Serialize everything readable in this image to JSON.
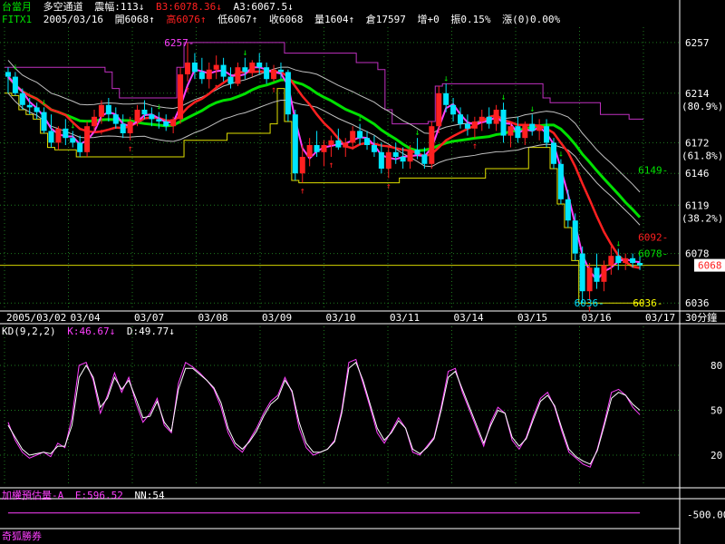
{
  "header1": {
    "symbol": "台當月",
    "strategy": "多空通道",
    "amplitude": "震幅:113↓",
    "b3": "B3:6078.36↓",
    "a3": "A3:6067.5↓"
  },
  "header2": {
    "code": "FITX1",
    "date": "2005/03/16",
    "open": "開6068↑",
    "high": "高6076↑",
    "low": "低6067↑",
    "close": "收6068",
    "volume": "量1604↑",
    "oi": "倉17597",
    "oi_change": "增+0",
    "range": "振0.15%",
    "change": "漲(0)0.00%"
  },
  "kd_header": {
    "name": "KD(9,2,2)",
    "k": "K:46.67↓",
    "d": "D:49.77↓"
  },
  "vol_header": {
    "name": "加權預估量-A",
    "e": "E:596.52",
    "nn": "NN:54"
  },
  "footer_label": "奇狐勝券",
  "colors": {
    "up": "#ff2020",
    "down": "#00e5ff",
    "grid": "#1e7a1e",
    "ma_green": "#00e000",
    "ma_red": "#ff2020",
    "ma_magenta": "#ff40ff",
    "band_upper": "#c030c0",
    "band_lower": "#e0e000",
    "k_line": "#ff40ff",
    "d_line": "#ffffff"
  },
  "chart_data": [
    {
      "type": "candlestick",
      "pane": "price",
      "interval": "30分鐘",
      "ylim": [
        6030,
        6270
      ],
      "y_ticks": [
        {
          "v": 6257,
          "label": "6257"
        },
        {
          "v": 6214,
          "label": "6214",
          "sub": "(80.9%)"
        },
        {
          "v": 6172,
          "label": "6172",
          "sub": "(61.8%)"
        },
        {
          "v": 6146,
          "label": "6146"
        },
        {
          "v": 6119,
          "label": "6119",
          "sub": "(38.2%)"
        },
        {
          "v": 6078,
          "label": "6078"
        },
        {
          "v": 6036,
          "label": "6036"
        }
      ],
      "current_price": "6068",
      "x_labels": [
        "2005/03/02",
        "03/04",
        "03/07",
        "03/08",
        "03/09",
        "03/10",
        "03/11",
        "03/14",
        "03/15",
        "03/16",
        "03/17"
      ],
      "annotations": [
        {
          "text": "6257",
          "x": 30,
          "v": 6257,
          "color": "#ff40ff"
        },
        {
          "text": "6149",
          "x": 119,
          "v": 6149,
          "color": "#00e000"
        },
        {
          "text": "6092",
          "x": 119,
          "v": 6092,
          "color": "#ff2020"
        },
        {
          "text": "6078",
          "x": 119,
          "v": 6078,
          "color": "#00e000"
        },
        {
          "text": "6036",
          "x": 107,
          "v": 6036,
          "color": "#00e5ff"
        },
        {
          "text": "6036",
          "x": 118,
          "v": 6036,
          "color": "#ffff00"
        }
      ],
      "candles": [
        {
          "o": 6232,
          "h": 6236,
          "l": 6214,
          "c": 6228
        },
        {
          "o": 6228,
          "h": 6232,
          "l": 6212,
          "c": 6214
        },
        {
          "o": 6214,
          "h": 6218,
          "l": 6200,
          "c": 6204
        },
        {
          "o": 6204,
          "h": 6210,
          "l": 6196,
          "c": 6202
        },
        {
          "o": 6202,
          "h": 6206,
          "l": 6192,
          "c": 6198
        },
        {
          "o": 6198,
          "h": 6202,
          "l": 6180,
          "c": 6182
        },
        {
          "o": 6182,
          "h": 6196,
          "l": 6168,
          "c": 6172
        },
        {
          "o": 6172,
          "h": 6186,
          "l": 6166,
          "c": 6184
        },
        {
          "o": 6184,
          "h": 6192,
          "l": 6170,
          "c": 6176
        },
        {
          "o": 6176,
          "h": 6182,
          "l": 6168,
          "c": 6172
        },
        {
          "o": 6172,
          "h": 6178,
          "l": 6160,
          "c": 6164
        },
        {
          "o": 6164,
          "h": 6190,
          "l": 6160,
          "c": 6186
        },
        {
          "o": 6186,
          "h": 6200,
          "l": 6180,
          "c": 6194
        },
        {
          "o": 6194,
          "h": 6208,
          "l": 6188,
          "c": 6204
        },
        {
          "o": 6204,
          "h": 6210,
          "l": 6190,
          "c": 6196
        },
        {
          "o": 6196,
          "h": 6202,
          "l": 6184,
          "c": 6188
        },
        {
          "o": 6188,
          "h": 6196,
          "l": 6176,
          "c": 6180
        },
        {
          "o": 6180,
          "h": 6194,
          "l": 6174,
          "c": 6190
        },
        {
          "o": 6190,
          "h": 6204,
          "l": 6186,
          "c": 6200
        },
        {
          "o": 6200,
          "h": 6208,
          "l": 6192,
          "c": 6196
        },
        {
          "o": 6196,
          "h": 6202,
          "l": 6186,
          "c": 6192
        },
        {
          "o": 6192,
          "h": 6198,
          "l": 6184,
          "c": 6190
        },
        {
          "o": 6190,
          "h": 6196,
          "l": 6182,
          "c": 6186
        },
        {
          "o": 6186,
          "h": 6194,
          "l": 6180,
          "c": 6192
        },
        {
          "o": 6192,
          "h": 6236,
          "l": 6188,
          "c": 6230
        },
        {
          "o": 6230,
          "h": 6257,
          "l": 6224,
          "c": 6240
        },
        {
          "o": 6240,
          "h": 6248,
          "l": 6226,
          "c": 6232
        },
        {
          "o": 6232,
          "h": 6244,
          "l": 6222,
          "c": 6226
        },
        {
          "o": 6226,
          "h": 6240,
          "l": 6218,
          "c": 6234
        },
        {
          "o": 6234,
          "h": 6246,
          "l": 6226,
          "c": 6238
        },
        {
          "o": 6238,
          "h": 6244,
          "l": 6224,
          "c": 6228
        },
        {
          "o": 6228,
          "h": 6236,
          "l": 6218,
          "c": 6222
        },
        {
          "o": 6222,
          "h": 6240,
          "l": 6220,
          "c": 6236
        },
        {
          "o": 6236,
          "h": 6244,
          "l": 6226,
          "c": 6232
        },
        {
          "o": 6232,
          "h": 6242,
          "l": 6228,
          "c": 6240
        },
        {
          "o": 6240,
          "h": 6248,
          "l": 6230,
          "c": 6236
        },
        {
          "o": 6236,
          "h": 6240,
          "l": 6222,
          "c": 6226
        },
        {
          "o": 6226,
          "h": 6238,
          "l": 6224,
          "c": 6234
        },
        {
          "o": 6234,
          "h": 6240,
          "l": 6226,
          "c": 6232
        },
        {
          "o": 6232,
          "h": 6234,
          "l": 6190,
          "c": 6196
        },
        {
          "o": 6196,
          "h": 6200,
          "l": 6140,
          "c": 6146
        },
        {
          "o": 6146,
          "h": 6170,
          "l": 6138,
          "c": 6160
        },
        {
          "o": 6160,
          "h": 6176,
          "l": 6152,
          "c": 6170
        },
        {
          "o": 6170,
          "h": 6182,
          "l": 6160,
          "c": 6164
        },
        {
          "o": 6164,
          "h": 6174,
          "l": 6152,
          "c": 6170
        },
        {
          "o": 6170,
          "h": 6178,
          "l": 6160,
          "c": 6174
        },
        {
          "o": 6174,
          "h": 6184,
          "l": 6166,
          "c": 6168
        },
        {
          "o": 6168,
          "h": 6176,
          "l": 6160,
          "c": 6172
        },
        {
          "o": 6172,
          "h": 6186,
          "l": 6166,
          "c": 6182
        },
        {
          "o": 6182,
          "h": 6188,
          "l": 6170,
          "c": 6176
        },
        {
          "o": 6176,
          "h": 6182,
          "l": 6166,
          "c": 6170
        },
        {
          "o": 6170,
          "h": 6178,
          "l": 6160,
          "c": 6164
        },
        {
          "o": 6164,
          "h": 6172,
          "l": 6146,
          "c": 6150
        },
        {
          "o": 6150,
          "h": 6168,
          "l": 6142,
          "c": 6164
        },
        {
          "o": 6164,
          "h": 6172,
          "l": 6154,
          "c": 6160
        },
        {
          "o": 6160,
          "h": 6168,
          "l": 6150,
          "c": 6156
        },
        {
          "o": 6156,
          "h": 6170,
          "l": 6150,
          "c": 6166
        },
        {
          "o": 6166,
          "h": 6176,
          "l": 6158,
          "c": 6162
        },
        {
          "o": 6162,
          "h": 6168,
          "l": 6150,
          "c": 6154
        },
        {
          "o": 6154,
          "h": 6190,
          "l": 6150,
          "c": 6186
        },
        {
          "o": 6186,
          "h": 6220,
          "l": 6180,
          "c": 6214
        },
        {
          "o": 6214,
          "h": 6222,
          "l": 6198,
          "c": 6204
        },
        {
          "o": 6204,
          "h": 6210,
          "l": 6190,
          "c": 6196
        },
        {
          "o": 6196,
          "h": 6202,
          "l": 6184,
          "c": 6188
        },
        {
          "o": 6188,
          "h": 6196,
          "l": 6178,
          "c": 6184
        },
        {
          "o": 6184,
          "h": 6194,
          "l": 6176,
          "c": 6190
        },
        {
          "o": 6190,
          "h": 6200,
          "l": 6182,
          "c": 6194
        },
        {
          "o": 6194,
          "h": 6202,
          "l": 6184,
          "c": 6188
        },
        {
          "o": 6188,
          "h": 6204,
          "l": 6182,
          "c": 6200
        },
        {
          "o": 6200,
          "h": 6206,
          "l": 6172,
          "c": 6178
        },
        {
          "o": 6178,
          "h": 6190,
          "l": 6168,
          "c": 6186
        },
        {
          "o": 6186,
          "h": 6194,
          "l": 6172,
          "c": 6176
        },
        {
          "o": 6176,
          "h": 6190,
          "l": 6170,
          "c": 6188
        },
        {
          "o": 6188,
          "h": 6196,
          "l": 6178,
          "c": 6182
        },
        {
          "o": 6182,
          "h": 6192,
          "l": 6174,
          "c": 6186
        },
        {
          "o": 6186,
          "h": 6192,
          "l": 6168,
          "c": 6172
        },
        {
          "o": 6172,
          "h": 6176,
          "l": 6150,
          "c": 6154
        },
        {
          "o": 6154,
          "h": 6158,
          "l": 6120,
          "c": 6124
        },
        {
          "o": 6124,
          "h": 6132,
          "l": 6100,
          "c": 6106
        },
        {
          "o": 6106,
          "h": 6112,
          "l": 6072,
          "c": 6078
        },
        {
          "o": 6078,
          "h": 6084,
          "l": 6036,
          "c": 6046
        },
        {
          "o": 6046,
          "h": 6070,
          "l": 6038,
          "c": 6066
        },
        {
          "o": 6066,
          "h": 6078,
          "l": 6048,
          "c": 6054
        },
        {
          "o": 6054,
          "h": 6072,
          "l": 6046,
          "c": 6068
        },
        {
          "o": 6068,
          "h": 6084,
          "l": 6060,
          "c": 6076
        },
        {
          "o": 6076,
          "h": 6082,
          "l": 6064,
          "c": 6070
        },
        {
          "o": 6070,
          "h": 6078,
          "l": 6064,
          "c": 6074
        },
        {
          "o": 6074,
          "h": 6078,
          "l": 6066,
          "c": 6070
        },
        {
          "o": 6070,
          "h": 6076,
          "l": 6064,
          "c": 6068
        }
      ]
    },
    {
      "type": "line",
      "pane": "kd",
      "ylim": [
        0,
        100
      ],
      "y_ticks": [
        80,
        50,
        20
      ],
      "series": [
        {
          "name": "K",
          "values": [
            42,
            30,
            22,
            18,
            20,
            22,
            19,
            28,
            25,
            45,
            80,
            82,
            70,
            48,
            60,
            75,
            62,
            72,
            55,
            42,
            48,
            58,
            40,
            35,
            68,
            82,
            79,
            75,
            70,
            64,
            52,
            35,
            26,
            22,
            30,
            38,
            48,
            56,
            60,
            72,
            62,
            38,
            25,
            20,
            22,
            24,
            30,
            50,
            82,
            84,
            68,
            52,
            35,
            28,
            36,
            45,
            38,
            22,
            20,
            26,
            32,
            52,
            76,
            78,
            62,
            50,
            38,
            26,
            42,
            52,
            48,
            30,
            24,
            32,
            46,
            58,
            62,
            52,
            36,
            22,
            18,
            14,
            12,
            24,
            42,
            62,
            64,
            60,
            52,
            47
          ]
        },
        {
          "name": "D",
          "values": [
            40,
            32,
            24,
            20,
            21,
            22,
            21,
            26,
            26,
            40,
            72,
            80,
            72,
            52,
            58,
            72,
            64,
            70,
            58,
            45,
            46,
            56,
            42,
            36,
            64,
            78,
            78,
            74,
            70,
            65,
            55,
            38,
            28,
            24,
            29,
            36,
            46,
            54,
            58,
            70,
            63,
            42,
            28,
            22,
            22,
            24,
            29,
            48,
            78,
            82,
            70,
            54,
            38,
            30,
            35,
            43,
            38,
            24,
            21,
            25,
            31,
            50,
            72,
            76,
            64,
            52,
            40,
            28,
            40,
            50,
            48,
            32,
            26,
            31,
            44,
            56,
            60,
            53,
            38,
            24,
            19,
            16,
            14,
            23,
            40,
            58,
            62,
            60,
            54,
            50
          ]
        }
      ]
    },
    {
      "type": "line",
      "pane": "volume-estimate",
      "ylim": [
        0,
        1000
      ],
      "y_ticks": [
        500
      ],
      "y_tick_labels": [
        "500.00"
      ],
      "series": [
        {
          "values": [
            560,
            560,
            560,
            560,
            560,
            560,
            560,
            560,
            560,
            560,
            560,
            560,
            560,
            560,
            560,
            560,
            560,
            560,
            560,
            560,
            560,
            560,
            560,
            560,
            560,
            560,
            560,
            560,
            560,
            560,
            560,
            560,
            560,
            560,
            560,
            560,
            560,
            560,
            560,
            560,
            560,
            560,
            560,
            560,
            560,
            560,
            560,
            560,
            560,
            560,
            560,
            560,
            560,
            560,
            560,
            560,
            560,
            560,
            560,
            560,
            560,
            560,
            560,
            560,
            560,
            560,
            560,
            560,
            560,
            560,
            560,
            560,
            560,
            560,
            560,
            560,
            560,
            560,
            560,
            560,
            560,
            560,
            560,
            560,
            560,
            560,
            560,
            560,
            560,
            560
          ]
        }
      ]
    }
  ]
}
